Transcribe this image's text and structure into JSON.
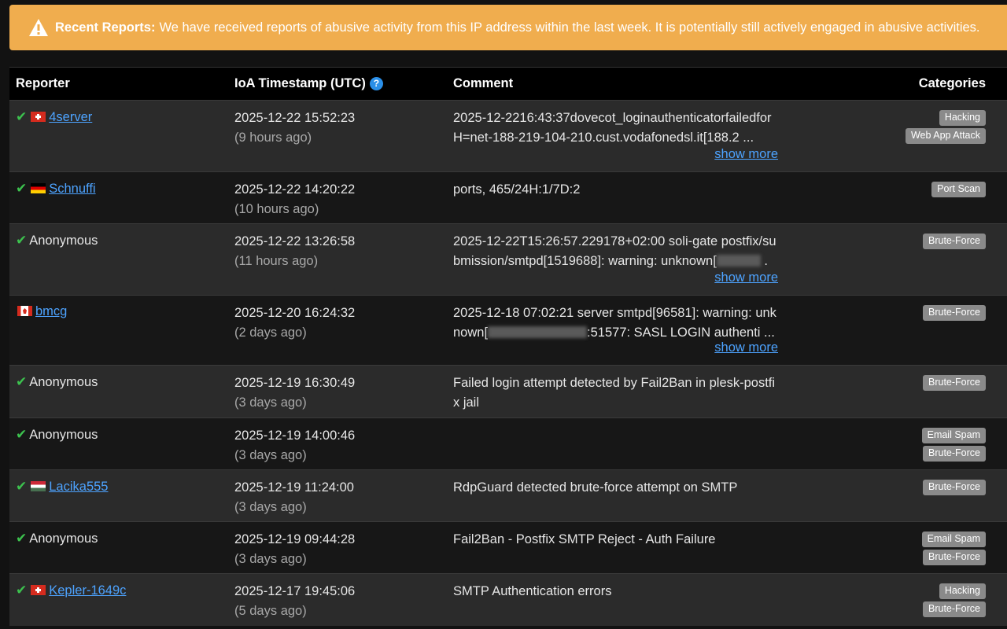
{
  "alert": {
    "icon": "warning-icon",
    "title": "Recent Reports:",
    "text": "We have received reports of abusive activity from this IP address within the last week. It is potentially still actively engaged in abusive activities."
  },
  "table": {
    "headers": {
      "reporter": "Reporter",
      "timestamp": "IoA Timestamp (UTC)",
      "comment": "Comment",
      "categories": "Categories"
    },
    "rows": [
      {
        "verified": true,
        "flag": "ch",
        "reporter": "4server",
        "is_link": true,
        "timestamp": "2025-12-22 15:52:23",
        "ago": "(9 hours ago)",
        "comment_lines": [
          "2025-12-2216:43:37dovecot_loginauthenticatorfailedfor",
          "H=net-188-219-104-210.cust.vodafonedsl.it[188.2 ..."
        ],
        "show_more": "show more",
        "categories": [
          "Hacking",
          "Web App Attack"
        ]
      },
      {
        "verified": true,
        "flag": "de",
        "reporter": "Schnuffi",
        "is_link": true,
        "timestamp": "2025-12-22 14:20:22",
        "ago": "(10 hours ago)",
        "comment_lines": [
          "ports, 465/24H:1/7D:2"
        ],
        "show_more": "",
        "categories": [
          "Port Scan"
        ]
      },
      {
        "verified": true,
        "flag": "",
        "reporter": "Anonymous",
        "is_link": false,
        "timestamp": "2025-12-22 13:26:58",
        "ago": "(11 hours ago)",
        "comment_lines": [
          "2025-12-22T15:26:57.229178+02:00 soli-gate postfix/su",
          "bmission/smtpd[1519688]: warning: unknown["
        ],
        "show_more": "show more",
        "categories": [
          "Brute-Force"
        ]
      },
      {
        "verified": false,
        "flag": "ca",
        "reporter": "bmcg",
        "is_link": true,
        "timestamp": "2025-12-20 16:24:32",
        "ago": "(2 days ago)",
        "comment_lines": [
          "2025-12-18 07:02:21 server smtpd[96581]: warning: unk",
          "nown["
        ],
        "comment_tail": ":51577: SASL LOGIN authenti ...",
        "show_more": "show more",
        "categories": [
          "Brute-Force"
        ]
      },
      {
        "verified": true,
        "flag": "",
        "reporter": "Anonymous",
        "is_link": false,
        "timestamp": "2025-12-19 16:30:49",
        "ago": "(3 days ago)",
        "comment_lines": [
          "Failed login attempt detected by Fail2Ban in plesk-postfi",
          "x jail"
        ],
        "show_more": "",
        "categories": [
          "Brute-Force"
        ]
      },
      {
        "verified": true,
        "flag": "",
        "reporter": "Anonymous",
        "is_link": false,
        "timestamp": "2025-12-19 14:00:46",
        "ago": "(3 days ago)",
        "comment_lines": [],
        "show_more": "",
        "categories": [
          "Email Spam",
          "Brute-Force"
        ]
      },
      {
        "verified": true,
        "flag": "hu",
        "reporter": "Lacika555",
        "is_link": true,
        "timestamp": "2025-12-19 11:24:00",
        "ago": "(3 days ago)",
        "comment_lines": [
          "RdpGuard detected brute-force attempt on SMTP"
        ],
        "show_more": "",
        "categories": [
          "Brute-Force"
        ]
      },
      {
        "verified": true,
        "flag": "",
        "reporter": "Anonymous",
        "is_link": false,
        "timestamp": "2025-12-19 09:44:28",
        "ago": "(3 days ago)",
        "comment_lines": [
          "Fail2Ban - Postfix SMTP Reject - Auth Failure"
        ],
        "show_more": "",
        "categories": [
          "Email Spam",
          "Brute-Force"
        ]
      },
      {
        "verified": true,
        "flag": "ch",
        "reporter": "Kepler-1649c",
        "is_link": true,
        "timestamp": "2025-12-17 19:45:06",
        "ago": "(5 days ago)",
        "comment_lines": [
          "SMTP Authentication errors"
        ],
        "show_more": "",
        "categories": [
          "Hacking",
          "Brute-Force"
        ]
      }
    ]
  },
  "colors": {
    "alert_bg": "#f0ad4e",
    "link": "#4da3ff",
    "check": "#3cc14e",
    "badge": "#8a8a8a"
  }
}
